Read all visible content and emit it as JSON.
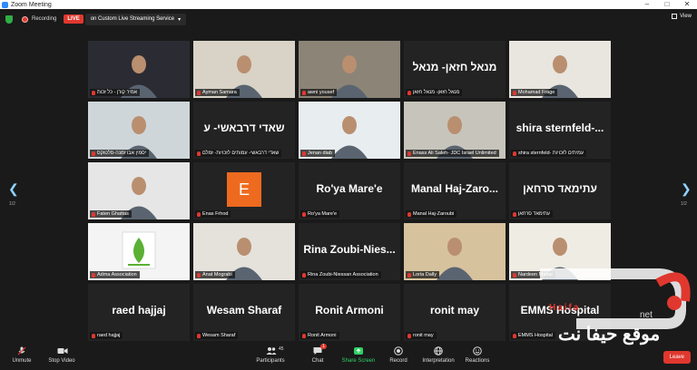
{
  "window": {
    "title": "Zoom Meeting"
  },
  "topbar": {
    "recording": "Recording",
    "live": "LIVE",
    "stream": "on Custom Live Streaming Service",
    "view": "View"
  },
  "pager": {
    "left": "1/2",
    "right": "1/2"
  },
  "tiles": [
    {
      "label": "אמיר קורן - כל זכות",
      "kind": "photo"
    },
    {
      "label": "Ayman Samara",
      "kind": "photo"
    },
    {
      "label": "awni yousef",
      "kind": "photo"
    },
    {
      "big": "מנאל חזאן- מנאל",
      "label": "מנאל חזאן- מנאל חזאן",
      "kind": "text"
    },
    {
      "label": "Mohamad Frage",
      "kind": "photo"
    },
    {
      "label": "יסמין אבו זמנה-סלטוקס",
      "kind": "photo"
    },
    {
      "big": "שאדי דרבאשי- ע",
      "label": "שאדי דרבאשי- עמותים לזכויות- זמלם",
      "kind": "text"
    },
    {
      "label": "Jenan diab",
      "kind": "photo"
    },
    {
      "label": "Enass Ali Saleh- JDC Israel Unlimited",
      "kind": "photo"
    },
    {
      "big": "shira sternfeld-...",
      "label": "shira sternfeld- עמיתים לזכויות",
      "kind": "text"
    },
    {
      "label": "Faten Ghattas",
      "kind": "photo"
    },
    {
      "label": "Enas Frhod",
      "kind": "avatar",
      "initial": "E"
    },
    {
      "big": "Ro'ya Mare'e",
      "label": "Ro'ya Mare'e",
      "kind": "text"
    },
    {
      "big": "Manal  Haj-Zaro...",
      "label": "Manal Haj-Zaroubi",
      "kind": "text"
    },
    {
      "big": "עתימאד סרחאן",
      "label": "עתימאד סרחאן",
      "kind": "text"
    },
    {
      "label": "Adma Association",
      "kind": "logo"
    },
    {
      "label": "Anat Mograbi",
      "kind": "photo"
    },
    {
      "big": "Rina  Zoubi-Nies...",
      "label": "Rina Zoubi-Niessan Association",
      "kind": "text"
    },
    {
      "label": "Loria Dally",
      "kind": "photo"
    },
    {
      "label": "Nardeen Mattar",
      "kind": "photo"
    },
    {
      "big": "raed hajjaj",
      "label": "raed hajjaj",
      "kind": "text"
    },
    {
      "big": "Wesam Sharaf",
      "label": "Wesam Sharaf",
      "kind": "text"
    },
    {
      "big": "Ronit Armoni",
      "label": "Ronit Armoni",
      "kind": "text"
    },
    {
      "big": "ronit may",
      "label": "ronit may",
      "kind": "text"
    },
    {
      "big": "EMMS Hospital",
      "label": "EMMS Hospital",
      "kind": "text"
    }
  ],
  "toolbar": {
    "unmute": "Unmute",
    "stop_video": "Stop Video",
    "participants": "Participants",
    "participants_count": "45",
    "chat": "Chat",
    "chat_badge": "1",
    "share": "Share Screen",
    "record": "Record",
    "interpretation": "Interpretation",
    "reactions": "Reactions",
    "leave": "Leave"
  },
  "watermark": {
    "brand": "Haifa",
    "suffix": "net",
    "arabic": "موقع حيفا نت"
  }
}
